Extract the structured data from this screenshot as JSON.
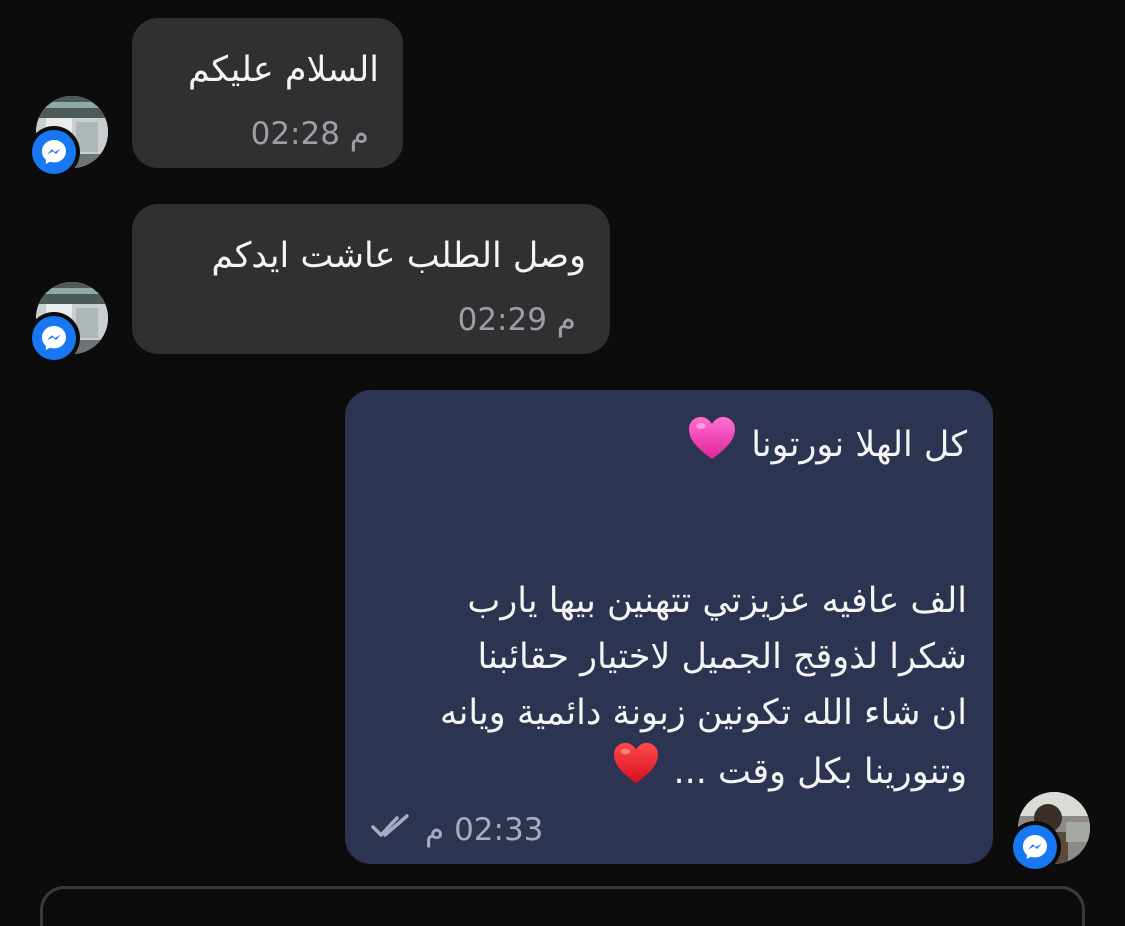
{
  "messages": [
    {
      "direction": "incoming",
      "text": "السلام عليكم",
      "time": "02:28 م",
      "avatar_icon": "messenger-icon"
    },
    {
      "direction": "incoming",
      "text": "وصل الطلب عاشت ايدكم",
      "time": "02:29 م",
      "avatar_icon": "messenger-icon"
    },
    {
      "direction": "outgoing",
      "greeting": "كل الهلا نورتونا",
      "greeting_emoji": "pink-heart-icon",
      "lines": [
        "الف عافيه عزيزتي تتهنين بيها يارب",
        "شكرا لذوقج الجميل لاختيار حقائبنا",
        "ان شاء الله تكونين زبونة دائمية ويانه",
        "وتنورينا بكل وقت ..."
      ],
      "closing_emoji": "red-heart-icon",
      "time": "02:33 م",
      "status_icon": "double-check-icon",
      "avatar_icon": "messenger-icon"
    }
  ],
  "colors": {
    "background": "#0c0c0d",
    "incoming_bubble": "#303032",
    "outgoing_bubble": "#2c3451",
    "messenger_blue": "#1877f2",
    "timestamp": "#9e9ea3"
  }
}
